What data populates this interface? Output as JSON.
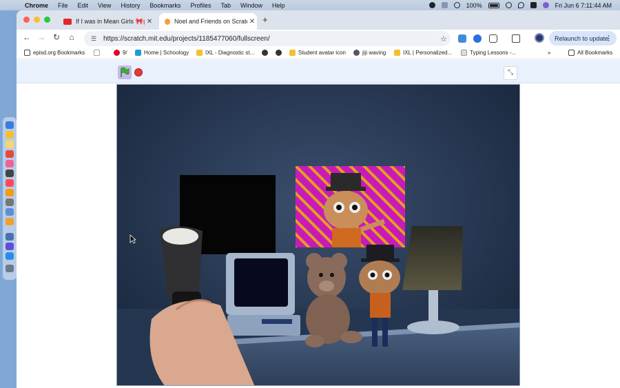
{
  "menubar": {
    "app": "Chrome",
    "items": [
      "File",
      "Edit",
      "View",
      "History",
      "Bookmarks",
      "Profiles",
      "Tab",
      "Window",
      "Help"
    ],
    "battery": "100%",
    "datetime": "Fri Jun 6  7:11:44 AM"
  },
  "tabs": [
    {
      "title": "If I was in Mean Girls 🎀💕 -",
      "favicon_color": "#e4252a"
    },
    {
      "title": "Noel and Friends on Scratch",
      "favicon_color": "#f2a03a"
    }
  ],
  "toolbar": {
    "url": "https://scratch.mit.edu/projects/1185477060/fullscreen/",
    "relaunch_label": "Relaunch to update"
  },
  "bookmarks": [
    {
      "label": "episd.org Bookmarks",
      "icon": "folder-icon"
    },
    {
      "label": "",
      "icon": "apps-grid-icon"
    },
    {
      "label": "9/",
      "icon": "pinterest-icon"
    },
    {
      "label": "Home | Schoology",
      "icon": "schoology-icon"
    },
    {
      "label": "IXL - Diagnostic st...",
      "icon": "ixl-icon"
    },
    {
      "label": "",
      "icon": "globe-icon"
    },
    {
      "label": "",
      "icon": "globe-icon"
    },
    {
      "label": "Student avatar icon",
      "icon": "ixl-icon"
    },
    {
      "label": "jiji waving",
      "icon": "site-icon"
    },
    {
      "label": "IXL | Personalized...",
      "icon": "ixl-icon"
    },
    {
      "label": "Typing Lessons -...",
      "icon": "typing-icon"
    },
    {
      "label": "All Bookmarks",
      "icon": "folder-icon"
    }
  ],
  "colors": {
    "tab_strip": "#dde3ec",
    "controls_bg": "#e9f1fc",
    "stop_red": "#e03a3a",
    "flag_green": "#3cae35",
    "stage_wall": "#1e2c44",
    "frame_magenta": "#c91ab8"
  }
}
